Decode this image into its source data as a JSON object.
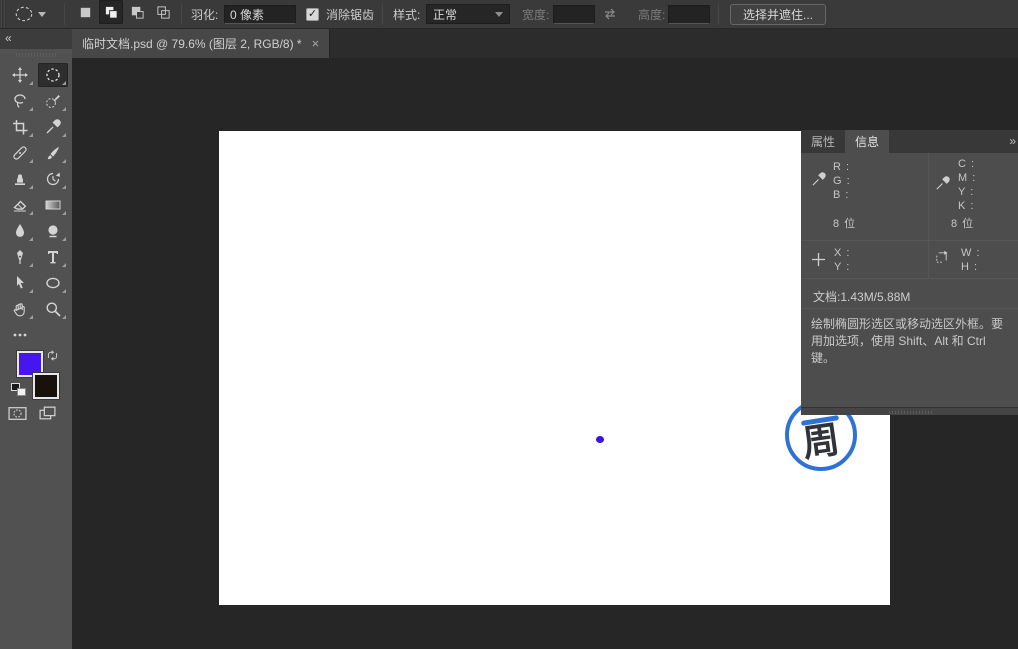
{
  "options_bar": {
    "feather_label": "羽化:",
    "feather_value": "0 像素",
    "antialias_checked": "✓",
    "antialias_label": "消除锯齿",
    "style_label": "样式:",
    "style_value": "正常",
    "width_label": "宽度:",
    "width_value": "",
    "height_label": "高度:",
    "height_value": "",
    "select_mask_button": "选择并遮住..."
  },
  "tab": {
    "title": "临时文档.psd @ 79.6% (图层 2, RGB/8) *",
    "close": "×"
  },
  "toolbar": {
    "collapse": "«",
    "foreground_color": "#4517ee",
    "background_color": "#17130c",
    "tools": [
      {
        "name": "move-tool",
        "icon": "move"
      },
      {
        "name": "elliptical-marquee-tool",
        "icon": "marquee",
        "selected": true
      },
      {
        "name": "lasso-tool",
        "icon": "lasso"
      },
      {
        "name": "quick-selection-tool",
        "icon": "quickselect"
      },
      {
        "name": "crop-tool",
        "icon": "crop"
      },
      {
        "name": "eyedropper-tool",
        "icon": "eyedropper"
      },
      {
        "name": "healing-brush-tool",
        "icon": "healing"
      },
      {
        "name": "brush-tool",
        "icon": "brush"
      },
      {
        "name": "clone-stamp-tool",
        "icon": "stamp"
      },
      {
        "name": "history-brush-tool",
        "icon": "historybrush"
      },
      {
        "name": "eraser-tool",
        "icon": "eraser"
      },
      {
        "name": "gradient-tool",
        "icon": "gradient"
      },
      {
        "name": "blur-tool",
        "icon": "blur"
      },
      {
        "name": "dodge-tool",
        "icon": "dodge"
      },
      {
        "name": "pen-tool",
        "icon": "pen"
      },
      {
        "name": "type-tool",
        "icon": "type"
      },
      {
        "name": "path-selection-tool",
        "icon": "pathselect"
      },
      {
        "name": "ellipse-shape-tool",
        "icon": "shape"
      },
      {
        "name": "hand-tool",
        "icon": "hand"
      },
      {
        "name": "zoom-tool",
        "icon": "zoom"
      },
      {
        "name": "edit-toolbar-button",
        "icon": "more"
      }
    ]
  },
  "canvas": {
    "dot_color": "#3a12e2",
    "logo": {
      "char": "周",
      "ring_color": "#2f72d6",
      "char_color": "#30343a"
    }
  },
  "info_panel": {
    "tabs": {
      "properties": "属性",
      "info": "信息"
    },
    "expand_icon": "»",
    "rgb": {
      "r": "R :",
      "g": "G :",
      "b": "B :",
      "depth": "8 位"
    },
    "cmyk": {
      "c": "C :",
      "m": "M :",
      "y": "Y :",
      "k": "K :",
      "depth": "8 位"
    },
    "coords": {
      "x": "X :",
      "y": "Y :",
      "w": "W :",
      "h": "H :"
    },
    "doc_size": "文档:1.43M/5.88M",
    "hint": "绘制椭圆形选区或移动选区外框。要用加选项，使用 Shift、Alt 和 Ctrl 键。"
  }
}
